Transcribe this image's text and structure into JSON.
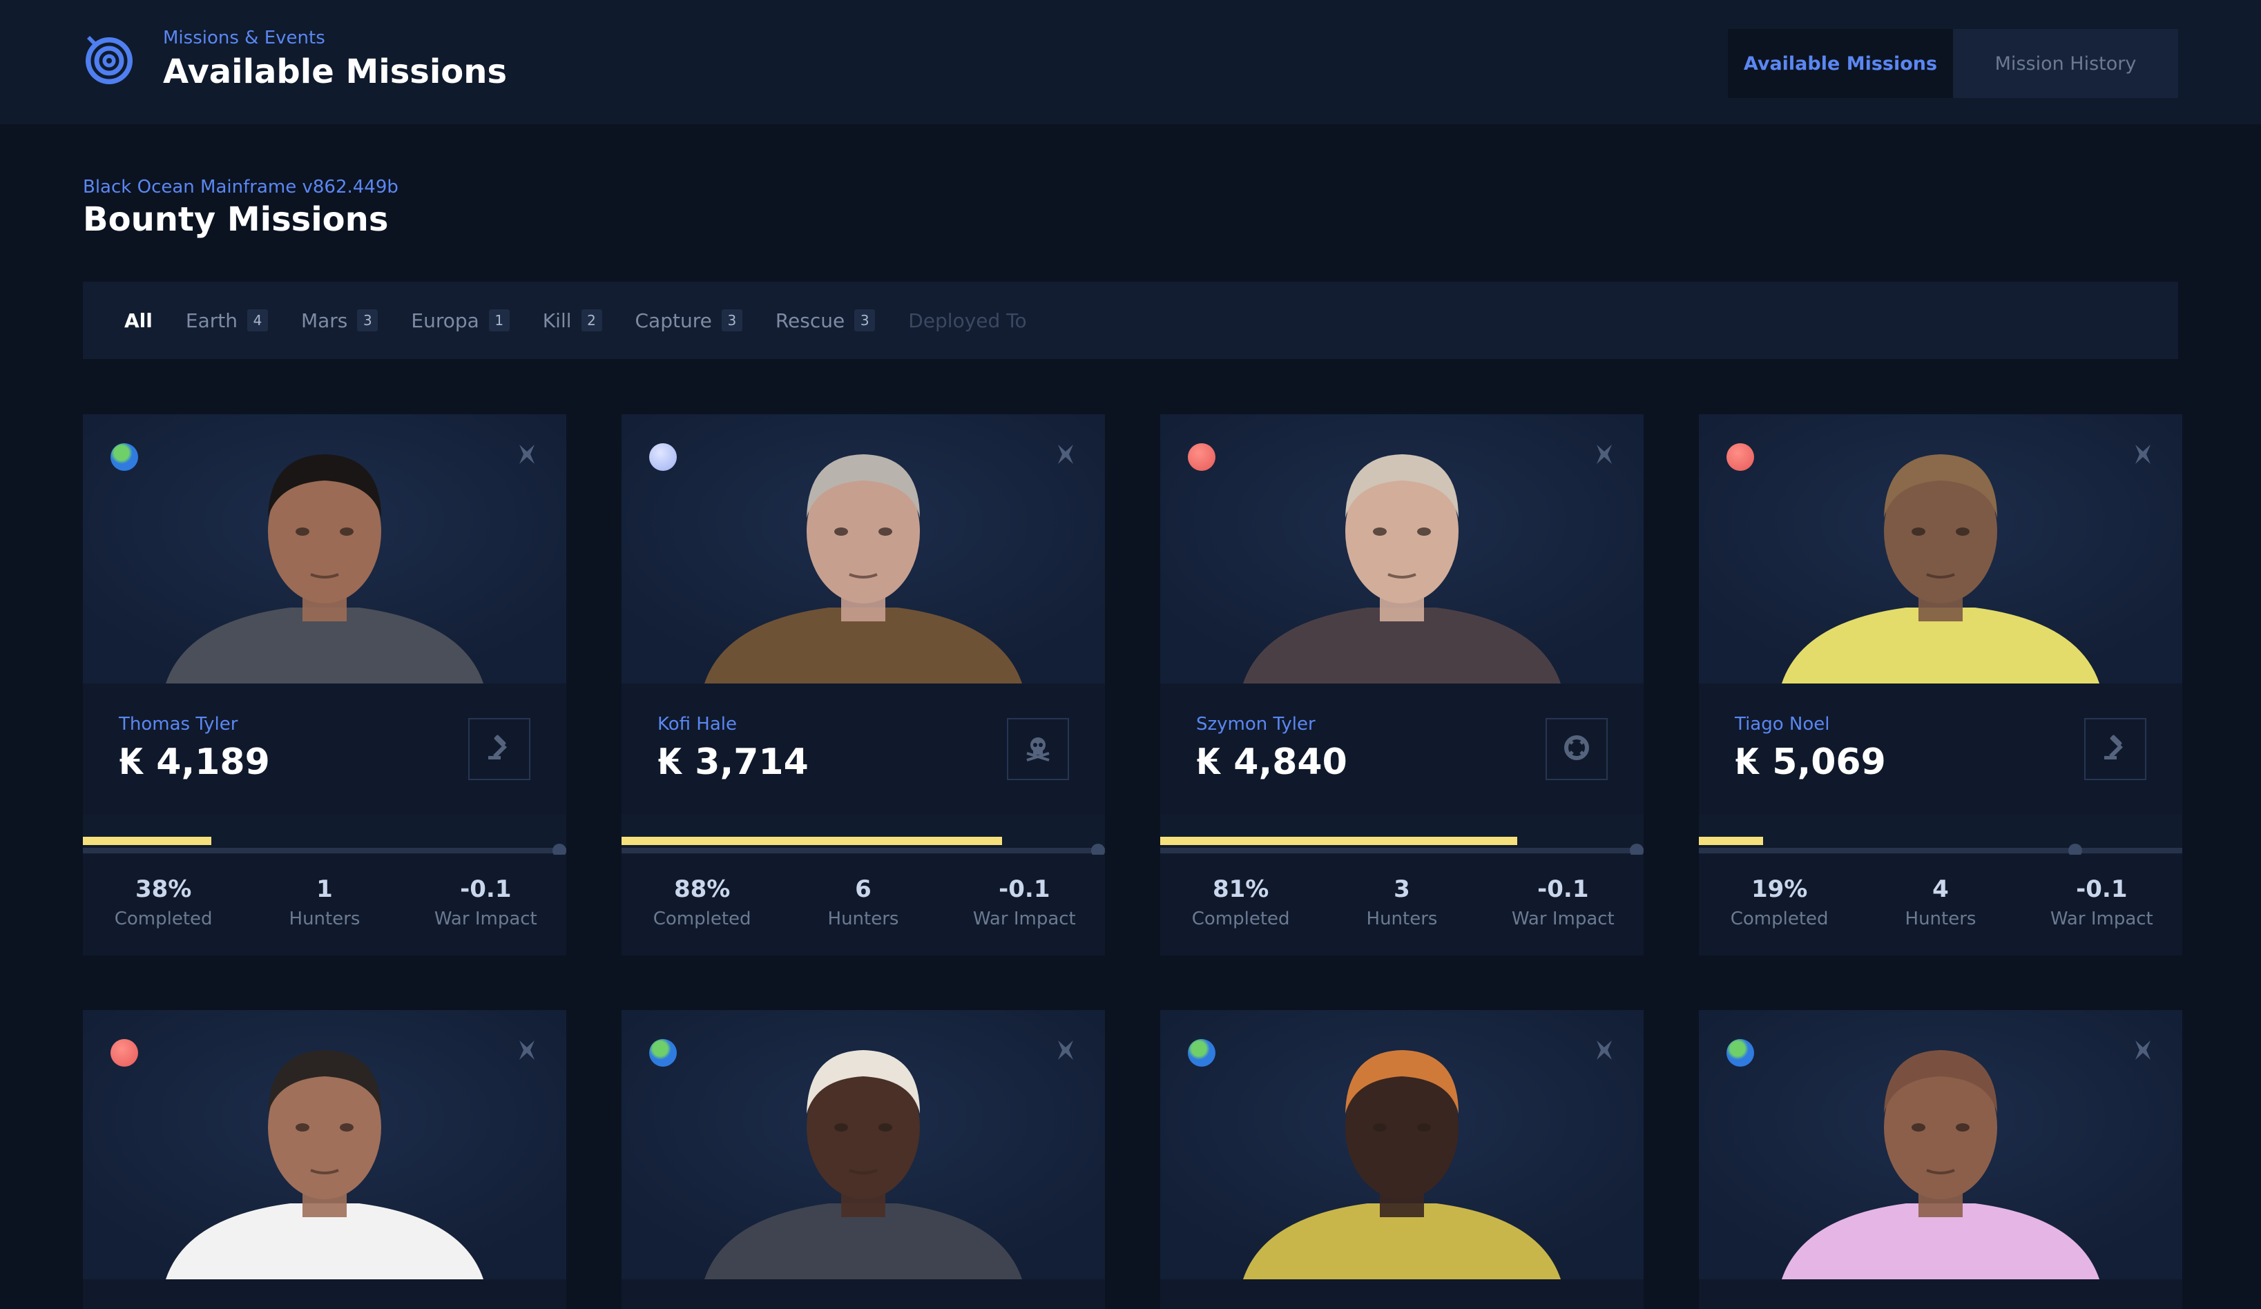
{
  "header": {
    "subtitle": "Missions & Events",
    "title": "Available Missions",
    "tabs": [
      {
        "label": "Available Missions",
        "active": true
      },
      {
        "label": "Mission History",
        "active": false
      }
    ]
  },
  "section": {
    "subtitle": "Black Ocean Mainframe v862.449b",
    "title": "Bounty Missions"
  },
  "filters": [
    {
      "label": "All",
      "count": null,
      "state": "active"
    },
    {
      "label": "Earth",
      "count": "4",
      "state": "normal"
    },
    {
      "label": "Mars",
      "count": "3",
      "state": "normal"
    },
    {
      "label": "Europa",
      "count": "1",
      "state": "normal"
    },
    {
      "label": "Kill",
      "count": "2",
      "state": "normal"
    },
    {
      "label": "Capture",
      "count": "3",
      "state": "normal"
    },
    {
      "label": "Rescue",
      "count": "3",
      "state": "normal"
    },
    {
      "label": "Deployed To",
      "count": null,
      "state": "disabled"
    }
  ],
  "stat_labels": {
    "completed": "Completed",
    "hunters": "Hunters",
    "war_impact": "War Impact"
  },
  "colors": {
    "accent": "#5b87f3",
    "progress": "#f6e07c",
    "background": "#0b1321",
    "card": "#101b2d"
  },
  "cards": [
    {
      "planet": "earth",
      "name": "Thomas Tyler",
      "reward": "₭ 4,189",
      "type_icon": "gavel-icon",
      "completed": "38%",
      "progress": 0.38,
      "hunters": "1",
      "war_impact": "-0.1",
      "skin": "#9b6b55",
      "hair": "#1a1616",
      "shirt": "#4a4f5a"
    },
    {
      "planet": "europa",
      "name": "Kofi Hale",
      "reward": "₭ 3,714",
      "type_icon": "skull-icon",
      "completed": "88%",
      "progress": 0.88,
      "hunters": "6",
      "war_impact": "-0.1",
      "skin": "#c79f8f",
      "hair": "#b9b3ad",
      "shirt": "#6e5236"
    },
    {
      "planet": "mars",
      "name": "Szymon Tyler",
      "reward": "₭ 4,840",
      "type_icon": "lifebuoy-icon",
      "completed": "81%",
      "progress": 0.81,
      "hunters": "3",
      "war_impact": "-0.1",
      "skin": "#d2ad9a",
      "hair": "#cfc4b6",
      "shirt": "#4b3f46"
    },
    {
      "planet": "mars",
      "name": "Tiago Noel",
      "reward": "₭ 5,069",
      "type_icon": "gavel-icon",
      "completed": "19%",
      "progress": 0.19,
      "hunters": "4",
      "war_impact": "-0.1",
      "skin": "#7d5a46",
      "hair": "#8a6a4a",
      "shirt": "#e3dc6a"
    },
    {
      "planet": "mars",
      "name": "",
      "reward": "",
      "type_icon": "",
      "completed": "",
      "progress": null,
      "hunters": "",
      "war_impact": "",
      "skin": "#a0705a",
      "hair": "#2a2522",
      "shirt": "#f2f2f2"
    },
    {
      "planet": "earth",
      "name": "",
      "reward": "",
      "type_icon": "",
      "completed": "",
      "progress": null,
      "hunters": "",
      "war_impact": "",
      "skin": "#4a3026",
      "hair": "#e9e3da",
      "shirt": "#3f4450"
    },
    {
      "planet": "earth",
      "name": "",
      "reward": "",
      "type_icon": "",
      "completed": "",
      "progress": null,
      "hunters": "",
      "war_impact": "",
      "skin": "#3a2620",
      "hair": "#d07a3a",
      "shirt": "#c9b64a"
    },
    {
      "planet": "earth",
      "name": "",
      "reward": "",
      "type_icon": "",
      "completed": "",
      "progress": null,
      "hunters": "",
      "war_impact": "",
      "skin": "#8c5f4a",
      "hair": "#7a5140",
      "shirt": "#e5b5e5"
    }
  ]
}
